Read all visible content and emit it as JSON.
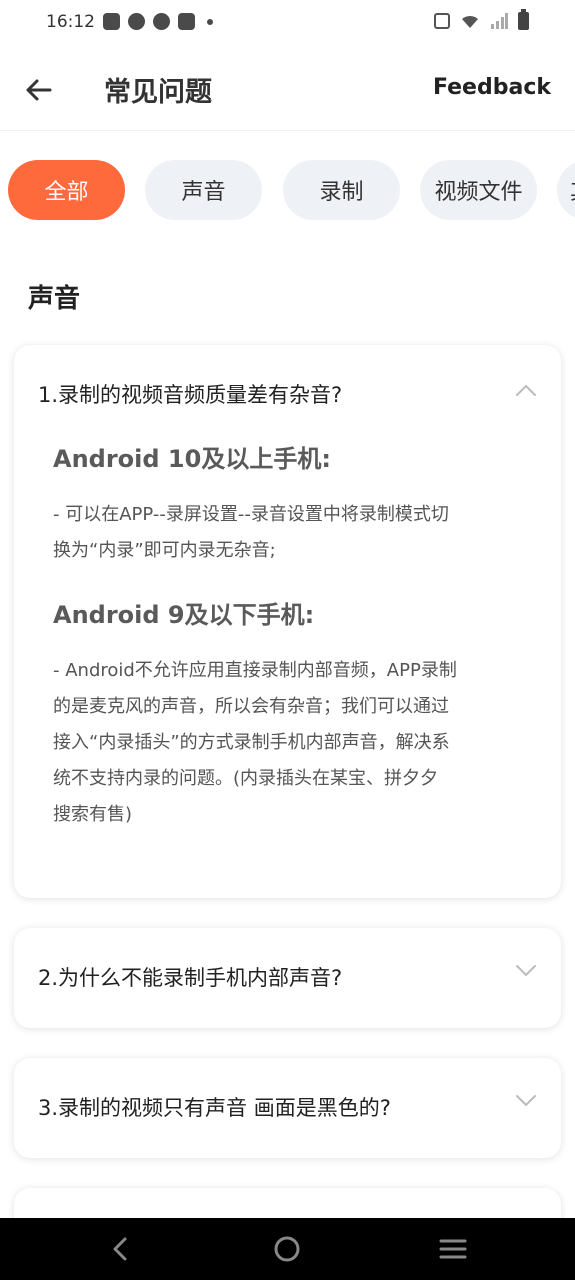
{
  "status_bar": {
    "time": "16:12"
  },
  "header": {
    "title": "常见问题",
    "feedback_label": "Feedback"
  },
  "tabs": [
    {
      "label": "全部",
      "active": true
    },
    {
      "label": "声音",
      "active": false
    },
    {
      "label": "录制",
      "active": false
    },
    {
      "label": "视频文件",
      "active": false
    },
    {
      "label": "其",
      "active": false
    }
  ],
  "section": {
    "title": "声音"
  },
  "faqs": [
    {
      "question": "1.录制的视频音频质量差有杂音?",
      "expanded": true,
      "answer": [
        {
          "heading": "Android 10及以上手机:",
          "lines": [
            "- 可以在APP--录屏设置--录音设置中将录制模式切",
            "换为“内录”即可内录无杂音;"
          ]
        },
        {
          "heading": "Android 9及以下手机:",
          "lines": [
            "- Android不允许应用直接录制内部音频，APP录制",
            "的是麦克风的声音，所以会有杂音；我们可以通过",
            "接入“内录插头”的方式录制手机内部声音，解决系",
            "统不支持内录的问题。(内录插头在某宝、拼夕夕",
            "搜索有售)"
          ]
        }
      ]
    },
    {
      "question": "2.为什么不能录制手机内部声音?",
      "expanded": false
    },
    {
      "question": "3.录制的视频只有声音 画面是黑色的?",
      "expanded": false
    }
  ],
  "icons": {
    "back": "arrow-left-icon",
    "expand": "chevron-down-icon",
    "collapse": "chevron-up-icon"
  },
  "colors": {
    "accent": "#ff6a3d",
    "tab_bg": "#eef1f5"
  }
}
